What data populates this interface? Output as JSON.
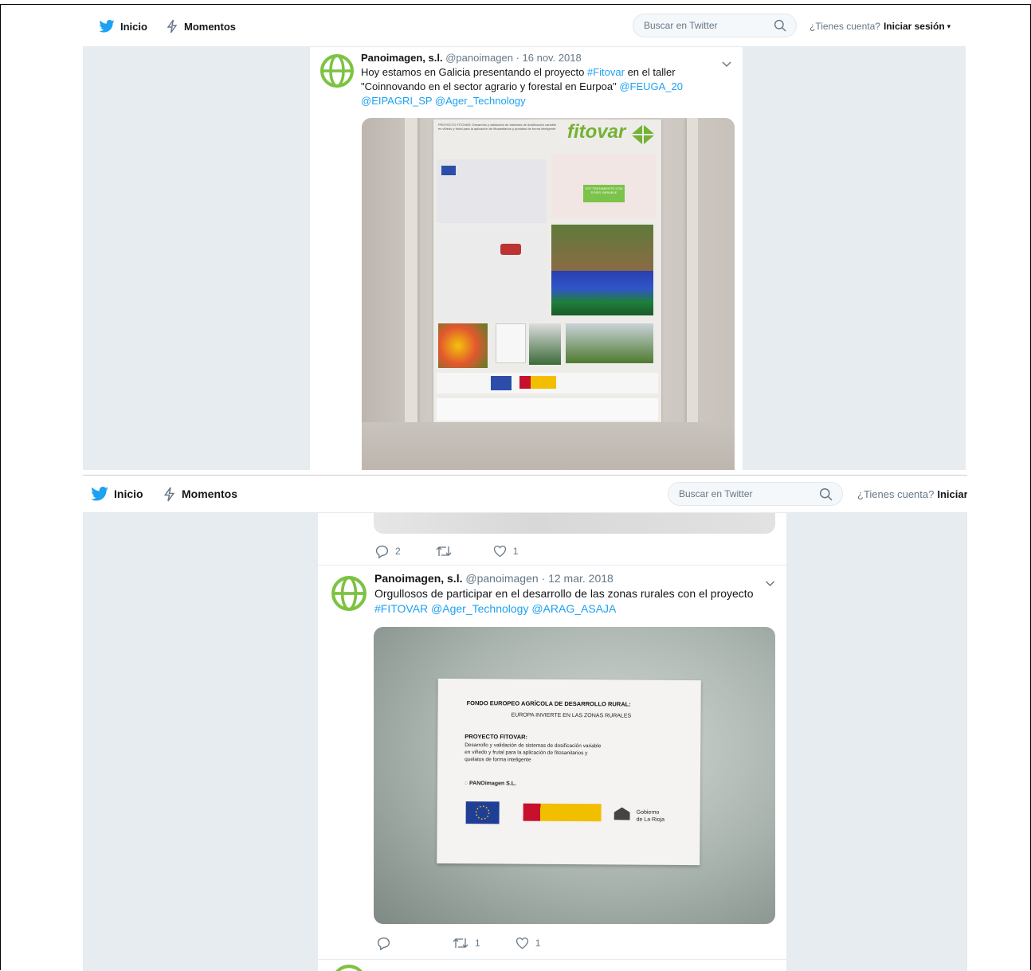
{
  "nav": {
    "home_label": "Inicio",
    "moments_label": "Momentos",
    "search_placeholder": "Buscar en Twitter",
    "login_question": "¿Tienes cuenta?",
    "login_link": "Iniciar sesión"
  },
  "colors": {
    "brand": "#1da1f2",
    "text": "#14171a",
    "muted": "#657786",
    "bg": "#e6ecf0",
    "avatar": "#7dc242"
  },
  "tweets": [
    {
      "name": "Panoimagen, s.l.",
      "handle": "@panoimagen · 16 nov. 2018",
      "line1_pre": "Hoy estamos en Galicia presentando el proyecto ",
      "line1_tag": "#Fitovar",
      "line1_post": " en el taller",
      "line2_pre": "\"Coinnovando en el sector agrario y forestal en Eurpoa\" ",
      "line2_mention": "@FEUGA_20",
      "line3": "@EIPAGRI_SP @Ager_Technology",
      "poster": {
        "brand": "fitovar",
        "header": "PROYECTO FITOVAR: Desarrollo y validación de sistemas de dosificación variable en viñedo y frutal para la aplicación de fitosanitarios y quelatos de forma inteligente",
        "tratamiento": "VRT TRATAMIENTO CON DOSIS VARIABLE"
      }
    },
    {
      "name": "Panoimagen, s.l.",
      "handle": "@panoimagen · 12 mar. 2018",
      "line1": "Orgullosos de participar en el desarrollo de las zonas rurales con el proyecto",
      "line2": "#FITOVAR @Ager_Technology @ARAG_ASAJA",
      "sign": {
        "title": "FONDO EUROPEO AGRÍCOLA DE DESARROLLO RURAL:",
        "subtitle": "EUROPA INVIERTE EN LAS ZONAS RURALES",
        "project": "PROYECTO FITOVAR:",
        "desc1": "Desarrollo y validación de sistemas de dosificación variable",
        "desc2": "en viñedo y frutal para la aplicación de fitosanitarios y",
        "desc3": "quelatos de forma inteligente",
        "company": "PANOimagen S.L.",
        "gov1": "Gobierno",
        "gov2": "de La Rioja"
      },
      "replies": "",
      "retweets": "1",
      "likes": "1"
    }
  ],
  "prev_tweet_actions": {
    "replies": "2",
    "retweets": "",
    "likes": "1"
  }
}
